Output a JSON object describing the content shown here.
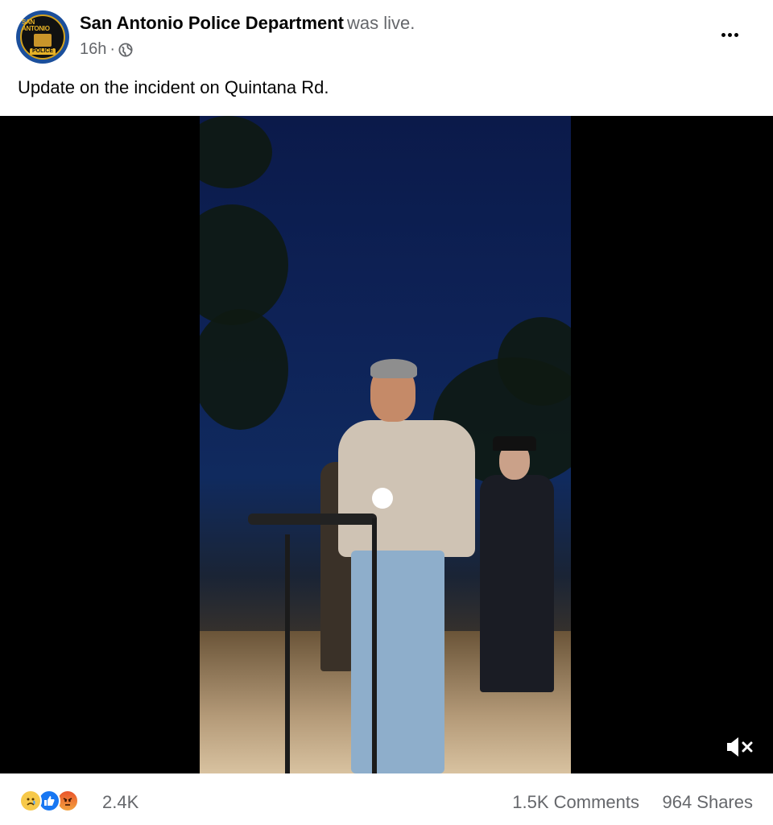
{
  "post": {
    "page_name": "San Antonio Police Department",
    "status": "was live.",
    "time": "16h",
    "separator": "·",
    "privacy_icon": "globe-icon",
    "caption": "Update on the incident on Quintana Rd."
  },
  "avatar": {
    "badge_top": "SAN ANTONIO",
    "badge_bottom": "POLICE"
  },
  "video": {
    "mute_icon": "volume-muted-icon"
  },
  "footer": {
    "reactions": [
      "sad",
      "like",
      "angry"
    ],
    "reaction_count": "2.4K",
    "comments": "1.5K Comments",
    "shares": "964 Shares"
  },
  "colors": {
    "secondary_text": "#65676b",
    "like_blue": "#1877f2",
    "badge_gold": "#e7b227"
  }
}
